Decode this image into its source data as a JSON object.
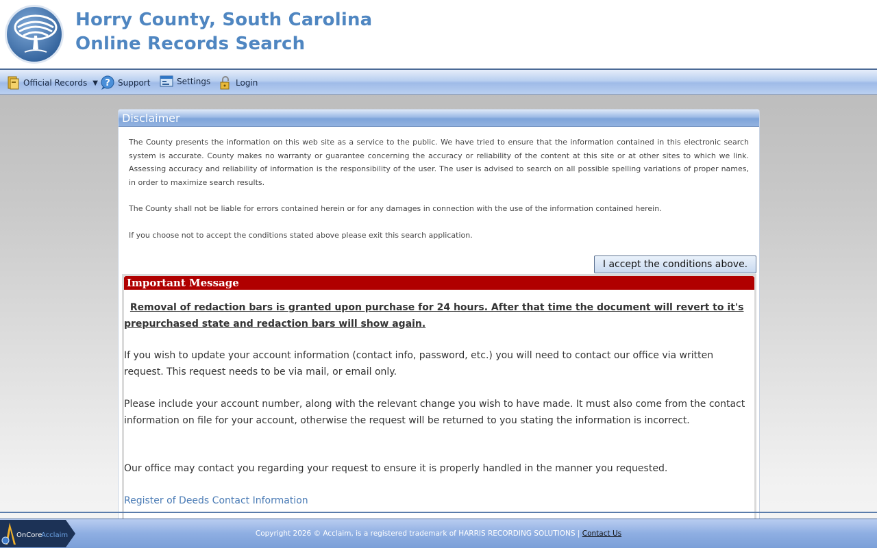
{
  "header": {
    "title_line1": "Horry County, South Carolina",
    "title_line2": "Online Records Search"
  },
  "nav": {
    "official_records": "Official Records",
    "support": "Support",
    "settings": "Settings",
    "login": "Login"
  },
  "disclaimer": {
    "title": "Disclaimer",
    "p1": "The County presents the information on this web site as a service to the public. We have tried to ensure that the information contained in this electronic search system is accurate. County makes no warranty or guarantee concerning the accuracy or reliability of the content at this site or at other sites to which we link. Assessing accuracy and reliability of information is the responsibility of the user. The user is advised to search on all possible spelling variations of proper names, in order to maximize search results.",
    "p2": "The County shall not be liable for errors contained herein or for any damages in connection with the use of the information contained herein.",
    "p3": "If you choose not to accept the conditions stated above please exit this search application.",
    "accept_label": "I accept the conditions above."
  },
  "important": {
    "title": "Important Message",
    "bold_notice": "Removal of redaction bars is granted upon purchase for 24 hours. After that time the document will revert to it's prepurchased state and redaction bars will show again.",
    "p1": "If you wish to update your account information (contact info, password, etc.) you will need to contact our office via written request. This request needs to be via mail, or email only.",
    "p2": "Please include your account number, along with the relevant change you wish to have made. It must also come from the contact information on file for your account, otherwise the request will be returned to you stating the information is incorrect.",
    "p3": "Our office may contact you regarding your request to ensure it is properly handled in the manner you requested.",
    "link": "Register of Deeds Contact Information"
  },
  "footer": {
    "logo_text_1": "OnCore",
    "logo_text_2": "Acclaim",
    "copyright": "Copyright 2026 © Acclaim, is a registered trademark of HARRIS RECORDING SOLUTIONS | ",
    "contact": "Contact Us"
  },
  "colors": {
    "title_blue": "#4f86c1",
    "important_red": "#b00000",
    "link_blue": "#4a7bb5"
  }
}
